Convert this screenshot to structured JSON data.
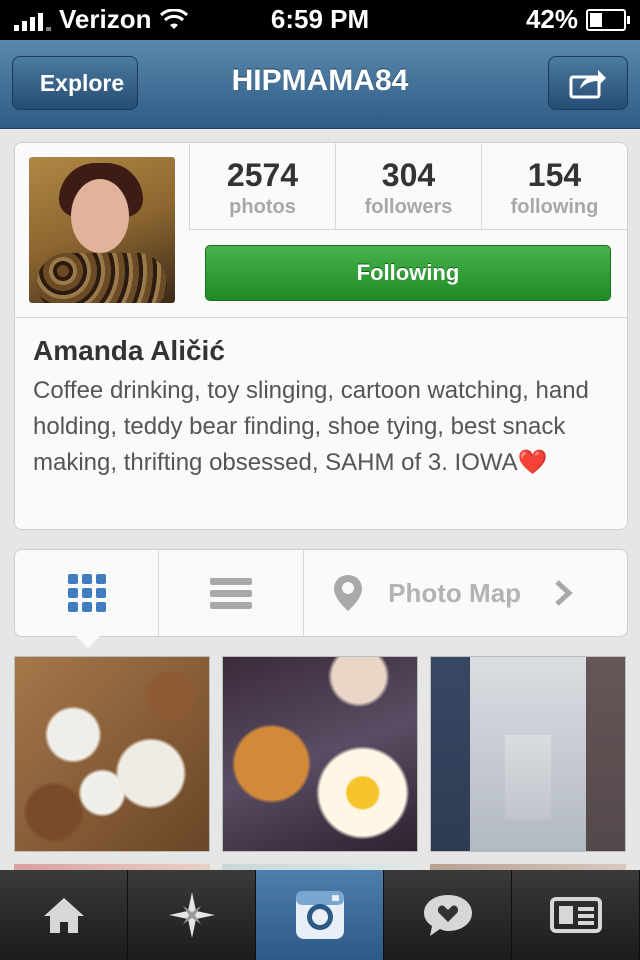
{
  "status_bar": {
    "carrier": "Verizon",
    "time": "6:59 PM",
    "battery": "42%"
  },
  "nav": {
    "back_label": "Explore",
    "title": "HIPMAMA84",
    "share_icon": "share-icon"
  },
  "profile": {
    "stats": [
      {
        "value": "2574",
        "label": "photos"
      },
      {
        "value": "304",
        "label": "followers"
      },
      {
        "value": "154",
        "label": "following"
      }
    ],
    "follow_button": "Following",
    "name": "Amanda Aličić",
    "bio": "Coffee drinking, toy slinging, cartoon watching, hand holding, teddy bear finding, shoe tying, best snack making, thrifting obsessed, SAHM of 3. IOWA",
    "bio_emoji": "❤️"
  },
  "view_options": {
    "photo_map_label": "Photo Map"
  },
  "colors": {
    "nav_blue": "#2f5b85",
    "follow_green": "#2ea233",
    "grid_blue": "#3f7cc0"
  },
  "tabs": [
    {
      "name": "home-icon"
    },
    {
      "name": "explore-icon"
    },
    {
      "name": "camera-icon"
    },
    {
      "name": "activity-icon"
    },
    {
      "name": "profile-icon"
    }
  ]
}
